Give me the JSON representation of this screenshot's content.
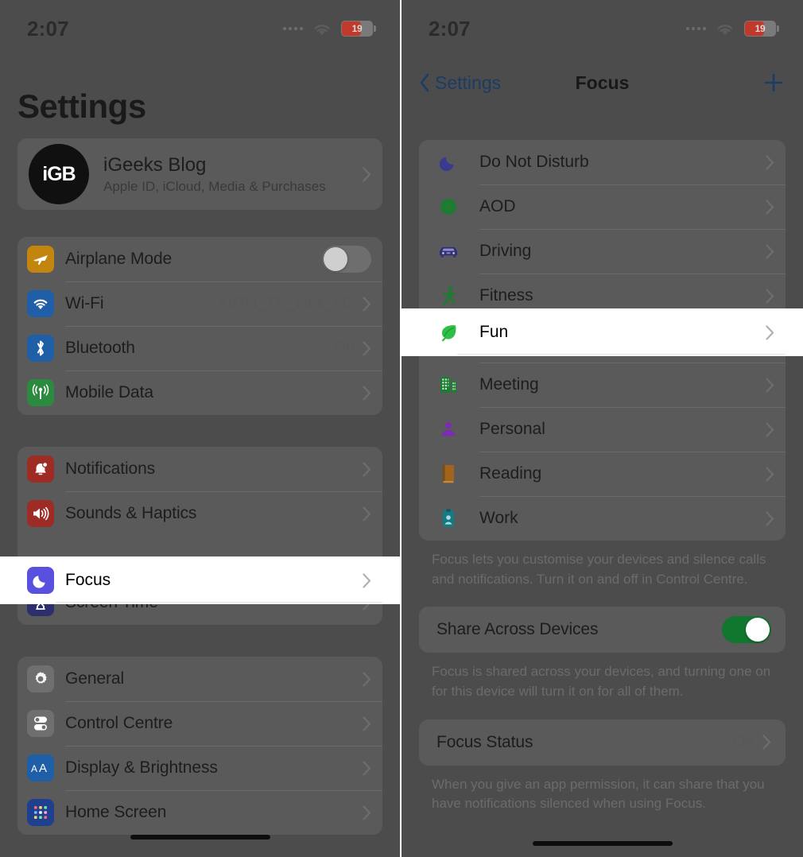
{
  "status_bar": {
    "time": "2:07",
    "signal_icon": "cellular-dots-icon",
    "wifi_icon": "wifi-icon",
    "battery_percent": "19",
    "battery_icon": "battery-icon"
  },
  "left_panel": {
    "title": "Settings",
    "apple_id": {
      "avatar_text": "iGB",
      "name": "iGeeks Blog",
      "subtitle": "Apple ID, iCloud, Media & Purchases",
      "chevron_icon": "chevron-right-icon"
    },
    "group_connectivity": [
      {
        "label": "Airplane Mode",
        "icon": "airplane-icon",
        "icon_color": "#c2860f",
        "control": "toggle",
        "toggle_on": false
      },
      {
        "label": "Wi-Fi",
        "icon": "wifi-icon",
        "icon_color": "#1f5fa8",
        "value": "AirTel_TP_Link_5G",
        "control": "chevron"
      },
      {
        "label": "Bluetooth",
        "icon": "bluetooth-icon",
        "icon_color": "#1f5fa8",
        "value": "On",
        "control": "chevron"
      },
      {
        "label": "Mobile Data",
        "icon": "antenna-icon",
        "icon_color": "#2a8a3e",
        "value": "",
        "control": "chevron"
      }
    ],
    "group_alerts": [
      {
        "label": "Notifications",
        "icon": "bell-icon",
        "icon_color": "#9e2b24",
        "control": "chevron"
      },
      {
        "label": "Sounds & Haptics",
        "icon": "speaker-icon",
        "icon_color": "#9e2b24",
        "control": "chevron"
      },
      {
        "label": "Focus",
        "icon": "moon-icon",
        "icon_color": "#5a50e0",
        "control": "chevron",
        "highlighted": true
      },
      {
        "label": "Screen Time",
        "icon": "hourglass-icon",
        "icon_color": "#2c2f6b",
        "control": "chevron"
      }
    ],
    "group_system": [
      {
        "label": "General",
        "icon": "gear-icon",
        "icon_color": "#6f6f6f",
        "control": "chevron"
      },
      {
        "label": "Control Centre",
        "icon": "sliders-icon",
        "icon_color": "#6f6f6f",
        "control": "chevron"
      },
      {
        "label": "Display & Brightness",
        "icon": "text-size-icon",
        "icon_color": "#1f5fa8",
        "control": "chevron"
      },
      {
        "label": "Home Screen",
        "icon": "app-grid-icon",
        "icon_color": "#1f3f8f",
        "control": "chevron"
      }
    ]
  },
  "right_panel": {
    "nav": {
      "back_label": "Settings",
      "back_icon": "chevron-left-icon",
      "title": "Focus",
      "add_icon": "plus-icon"
    },
    "focus_modes": [
      {
        "label": "Do Not Disturb",
        "icon": "moon-icon",
        "icon_color": "#3b3a8f"
      },
      {
        "label": "AOD",
        "icon": "circle-icon",
        "icon_color": "#1f7a33"
      },
      {
        "label": "Driving",
        "icon": "car-icon",
        "icon_color": "#323076"
      },
      {
        "label": "Fitness",
        "icon": "running-person-icon",
        "icon_color": "#1f7a33"
      },
      {
        "label": "Fun",
        "icon": "leaf-icon",
        "icon_color": "#2fbf46",
        "highlighted": true
      },
      {
        "label": "Meeting",
        "icon": "buildings-icon",
        "icon_color": "#1f7a33"
      },
      {
        "label": "Personal",
        "icon": "person-icon",
        "icon_color": "#7b2bb5"
      },
      {
        "label": "Reading",
        "icon": "book-icon",
        "icon_color": "#a0651a"
      },
      {
        "label": "Work",
        "icon": "id-badge-icon",
        "icon_color": "#157a82"
      }
    ],
    "focus_footnote": "Focus lets you customise your devices and silence calls and notifications. Turn it on and off in Control Centre.",
    "share_across_devices": {
      "label": "Share Across Devices",
      "toggle_on": true
    },
    "share_footnote": "Focus is shared across your devices, and turning one on for this device will turn it on for all of them.",
    "focus_status": {
      "label": "Focus Status",
      "value": "On",
      "chevron_icon": "chevron-right-icon"
    },
    "status_footnote": "When you give an app permission, it can share that you have notifications silenced when using Focus."
  }
}
